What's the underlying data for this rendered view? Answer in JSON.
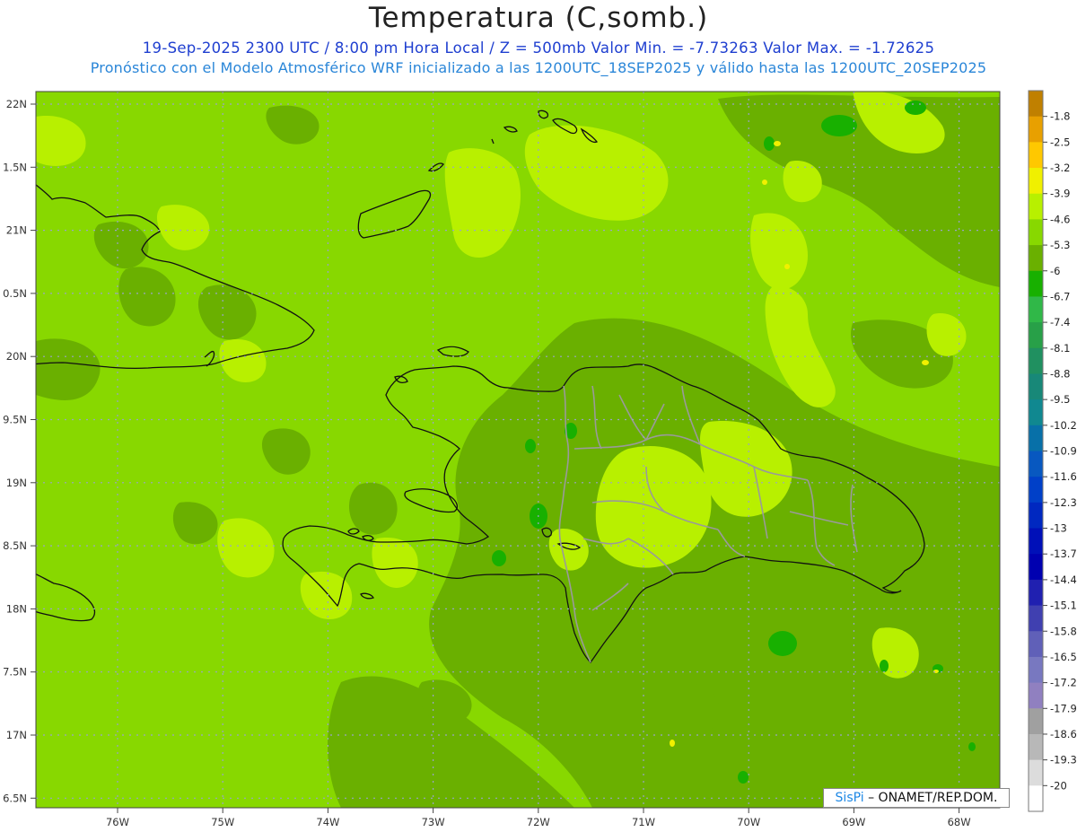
{
  "header": {
    "title": "Temperatura (C,somb.)",
    "subtitle_1": "19-Sep-2025  2300 UTC / 8:00 pm Hora Local / Z = 500mb  Valor Min. = -7.73263  Valor Max. = -1.72625",
    "subtitle_2": "Pronóstico con el Modelo Atmosférico WRF inicializado a las 1200UTC_18SEP2025 y válido hasta las  1200UTC_20SEP2025"
  },
  "map": {
    "lat_labels": [
      "22N",
      "1.5N",
      "21N",
      "0.5N",
      "20N",
      "9.5N",
      "19N",
      "8.5N",
      "18N",
      "7.5N",
      "17N",
      "6.5N"
    ],
    "lon_labels": [
      "76W",
      "75W",
      "74W",
      "73W",
      "72W",
      "71W",
      "70W",
      "69W",
      "68W"
    ],
    "value_min": -7.73263,
    "value_max": -1.72625
  },
  "legend": {
    "labels": [
      "-1.8",
      "-2.5",
      "-3.2",
      "-3.9",
      "-4.6",
      "-5.3",
      "-6",
      "-6.7",
      "-7.4",
      "-8.1",
      "-8.8",
      "-9.5",
      "-10.2",
      "-10.9",
      "-11.6",
      "-12.3",
      "-13",
      "-13.7",
      "-14.4",
      "-15.1",
      "-15.8",
      "-16.5",
      "-17.2",
      "-17.9",
      "-18.6",
      "-19.3",
      "-20"
    ],
    "colors": [
      "#c08000",
      "#e8a000",
      "#ffc800",
      "#f0f000",
      "#b8f000",
      "#88d800",
      "#6ab000",
      "#18b000",
      "#30b848",
      "#28a048",
      "#209060",
      "#188878",
      "#108890",
      "#0870a8",
      "#0858c0",
      "#0040c8",
      "#0028c0",
      "#0010b8",
      "#0000b0",
      "#2020b0",
      "#4040b0",
      "#6060b8",
      "#7878c0",
      "#9080c0",
      "#a0a0a0",
      "#b8b8b8",
      "#dcdcdc",
      "#ffffff"
    ]
  },
  "credit": {
    "brand": "SisPi",
    "text": "– ONAMET/REP.DOM."
  }
}
